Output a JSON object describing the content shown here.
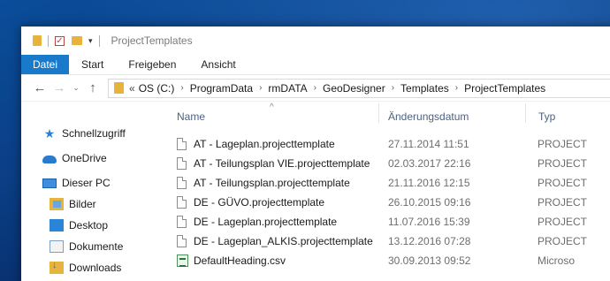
{
  "window": {
    "title": "ProjectTemplates"
  },
  "ribbon": {
    "tabs": [
      {
        "label": "Datei",
        "active": true
      },
      {
        "label": "Start"
      },
      {
        "label": "Freigeben"
      },
      {
        "label": "Ansicht"
      }
    ]
  },
  "address": {
    "prefix": "«",
    "crumbs": [
      "OS (C:)",
      "ProgramData",
      "rmDATA",
      "GeoDesigner",
      "Templates",
      "ProjectTemplates"
    ],
    "separator": "›"
  },
  "nav_buttons": {
    "back": "←",
    "forward": "→",
    "recent": "⌄",
    "up": "↑"
  },
  "navpane": {
    "quick_access": {
      "label": "Schnellzugriff",
      "icon": "star-icon"
    },
    "onedrive": {
      "label": "OneDrive",
      "icon": "cloud-icon"
    },
    "this_pc": {
      "label": "Dieser PC",
      "icon": "computer-icon"
    },
    "children": [
      {
        "label": "Bilder",
        "icon": "pictures-folder-icon"
      },
      {
        "label": "Desktop",
        "icon": "desktop-folder-icon"
      },
      {
        "label": "Dokumente",
        "icon": "documents-folder-icon"
      },
      {
        "label": "Downloads",
        "icon": "downloads-folder-icon"
      }
    ]
  },
  "columns": {
    "name": "Name",
    "date": "Änderungsdatum",
    "type": "Typ"
  },
  "files": [
    {
      "name": "AT - Lageplan.projecttemplate",
      "date": "27.11.2014 11:51",
      "type": "PROJECT",
      "icon": "file-icon"
    },
    {
      "name": "AT - Teilungsplan VIE.projecttemplate",
      "date": "02.03.2017 22:16",
      "type": "PROJECT",
      "icon": "file-icon"
    },
    {
      "name": "AT - Teilungsplan.projecttemplate",
      "date": "21.11.2016 12:15",
      "type": "PROJECT",
      "icon": "file-icon"
    },
    {
      "name": "DE - GÜVO.projecttemplate",
      "date": "26.10.2015 09:16",
      "type": "PROJECT",
      "icon": "file-icon"
    },
    {
      "name": "DE - Lageplan.projecttemplate",
      "date": "11.07.2016 15:39",
      "type": "PROJECT",
      "icon": "file-icon"
    },
    {
      "name": "DE - Lageplan_ALKIS.projecttemplate",
      "date": "13.12.2016 07:28",
      "type": "PROJECT",
      "icon": "file-icon"
    },
    {
      "name": "DefaultHeading.csv",
      "date": "30.09.2013 09:52",
      "type": "Microso",
      "icon": "csv-file-icon"
    }
  ]
}
